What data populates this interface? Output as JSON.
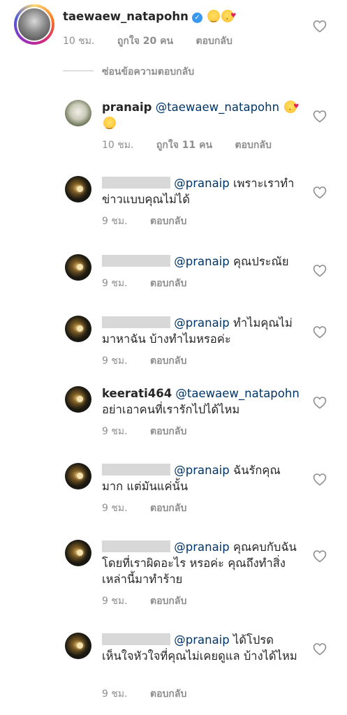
{
  "main_comment": {
    "username": "taewaew_natapohn",
    "time": "10 ชม.",
    "likes": "ถูกใจ 20 คน",
    "reply": "ตอบกลับ"
  },
  "hide_replies": "ซ่อนข้อความตอบกลับ",
  "replies": [
    {
      "username": "pranaip",
      "mention": "@taewaew_natapohn",
      "text": "",
      "time": "10 ชม.",
      "likes": "ถูกใจ 11 คน",
      "reply": "ตอบกลับ"
    },
    {
      "username": "",
      "mention": "@pranaip",
      "text": "เพราะเราทำข่าวแบบคุณไม่ได้",
      "time": "9 ชม.",
      "reply": "ตอบกลับ"
    },
    {
      "username": "",
      "mention": "@pranaip",
      "text": "คุณประณัย",
      "time": "9 ชม.",
      "reply": "ตอบกลับ"
    },
    {
      "username": "",
      "mention": "@pranaip",
      "text": "ทำไมคุณไม่มาหาฉัน บ้างทำไมหรอค่ะ",
      "time": "9 ชม.",
      "reply": "ตอบกลับ"
    },
    {
      "username": "keerati464",
      "mention": "@taewaew_natapohn",
      "text": "อย่าเอาคนที่เรารักไปได้ไหม",
      "time": "9 ชม.",
      "reply": "ตอบกลับ"
    },
    {
      "username": "",
      "mention": "@pranaip",
      "text": "ฉันรักคุณมาก แต่มันแค่นั้น",
      "time": "9 ชม.",
      "reply": "ตอบกลับ"
    },
    {
      "username": "",
      "mention": "@pranaip",
      "text": "คุณคบกับฉัน โดยที่เราผิดอะไร หรอค่ะ คุณถึงทำสิ่งเหล่านี้มาทำร้าย",
      "time": "9 ชม.",
      "reply": "ตอบกลับ"
    },
    {
      "username": "",
      "mention": "@pranaip",
      "text": "ได้โปรดเห็นใจหัวใจที่คุณไม่เคยดูแล บ้างได้ไหม",
      "time": "9 ชม.",
      "reply": "ตอบกลับ"
    }
  ]
}
